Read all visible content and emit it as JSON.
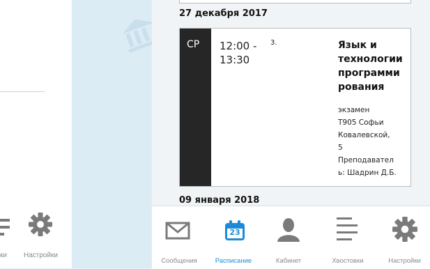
{
  "left_panel": {
    "tabs": [
      {
        "label": "ки",
        "icon": "list-icon"
      },
      {
        "label": "Настройки",
        "icon": "gear-icon"
      }
    ]
  },
  "schedule": {
    "days": [
      {
        "date": "27 декабря 2017",
        "lessons": [
          {
            "weekday": "СР",
            "time": "12:00 -\n13:30",
            "pair": "3.",
            "subject": "Язык и технологии программи рования",
            "details": [
              "экзамен",
              "Т905 Софьи",
              "Ковалевской,",
              "5",
              "Преподавател",
              "ь: Шадрин Д.Б."
            ]
          }
        ]
      },
      {
        "date": "09 января 2018"
      }
    ]
  },
  "tabbar": {
    "tabs": [
      {
        "label": "Сообщения",
        "icon": "envelope-icon",
        "active": false
      },
      {
        "label": "Расписание",
        "icon": "calendar-icon",
        "icon_text": "23",
        "active": true
      },
      {
        "label": "Кабинет",
        "icon": "person-icon",
        "active": false
      },
      {
        "label": "Хвостовки",
        "icon": "list-icon",
        "active": false
      },
      {
        "label": "Настройки",
        "icon": "gear-icon",
        "active": false
      }
    ]
  },
  "colors": {
    "accent": "#1c8ad6",
    "day_column": "#262626",
    "inactive_icon": "#7a7a7a"
  }
}
